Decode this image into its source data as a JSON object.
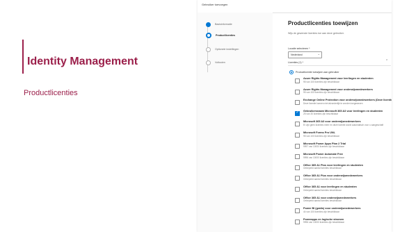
{
  "slide": {
    "title": "Identity Management",
    "subtitle": "Productlicenties",
    "accent_color": "#9b1f4a"
  },
  "screenshot": {
    "header_title": "Gebruiker toevoegen",
    "steps": [
      {
        "label": "Basisinformatie",
        "state": "done"
      },
      {
        "label": "Productlicenties",
        "state": "active"
      },
      {
        "label": "Optionele instellingen",
        "state": "pending"
      },
      {
        "label": "Voltooien",
        "state": "pending"
      }
    ],
    "panel": {
      "title": "Productlicenties toewijzen",
      "description": "Wijs de gewenste licenties toe aan deze gebruiker.",
      "location_label": "Locatie selecteren *",
      "location_value": "Nederland",
      "licenses_label": "Licenties (1) *",
      "radio_label": "Productlicentie toewijzen aan gebruiker"
    },
    "licenses": [
      {
        "name": "Azure Rights Management voor leerlingen en studenten",
        "availability": "95 van 100 licenties zijn beschikbaar",
        "checked": false
      },
      {
        "name": "Azure Rights Management voor onderwijsmedewerkers",
        "availability": "95 van 100 licenties zijn beschikbaar",
        "checked": false
      },
      {
        "name": "Exchange Online Protection voor onderwijsmedewerkers (Deze licentie heeft u niet afzonderlijk toe te wijzen)",
        "availability": "Deze licentie kunnen niet afzonderlijk te worden toegewezen",
        "checked": false
      },
      {
        "name": "Gebruikersnaam Microsoft 365 A3 voor leerlingen en studenten",
        "availability": "25 van 30 licenties zijn beschikbaar",
        "checked": true
      },
      {
        "name": "Microsoft 365 A3 voor onderwijsmedewerkers",
        "availability": "Er zijn geen licenties meer en deze licentie wordt automatisch voor u aangeschaft",
        "checked": false
      },
      {
        "name": "Microsoft Forms Pro UNL",
        "availability": "95 van 100 licenties zijn beschikbaar",
        "checked": false
      },
      {
        "name": "Microsoft Power Apps Plan 2 Trial",
        "availability": "9997 van 10000 licenties zijn beschikbaar",
        "checked": false
      },
      {
        "name": "Microsoft Power Automate Free",
        "availability": "9996 van 10000 licenties zijn beschikbaar",
        "checked": false
      },
      {
        "name": "Office 365 A1 Plus voor leerlingen en studenten",
        "availability": "Onbeperkt aantal licenties beschikbaar",
        "checked": false
      },
      {
        "name": "Office 365 A1 Plus voor onderwijsmedewerkers",
        "availability": "Onbeperkt aantal licenties beschikbaar",
        "checked": false
      },
      {
        "name": "Office 365 A1 voor leerlingen en studenten",
        "availability": "Onbeperkt aantal licenties beschikbaar",
        "checked": false
      },
      {
        "name": "Office 365 A1 voor onderwijsmedewerkers",
        "availability": "Onbeperkt aantal licenties beschikbaar",
        "checked": false
      },
      {
        "name": "Power BI (gratis) voor onderwijsmedewerkers",
        "availability": "44 van 100 licenties zijn beschikbaar",
        "checked": false
      },
      {
        "name": "Powerapps en logische stromen",
        "availability": "9996 van 10000 licenties zijn beschikbaar",
        "checked": false
      }
    ]
  }
}
